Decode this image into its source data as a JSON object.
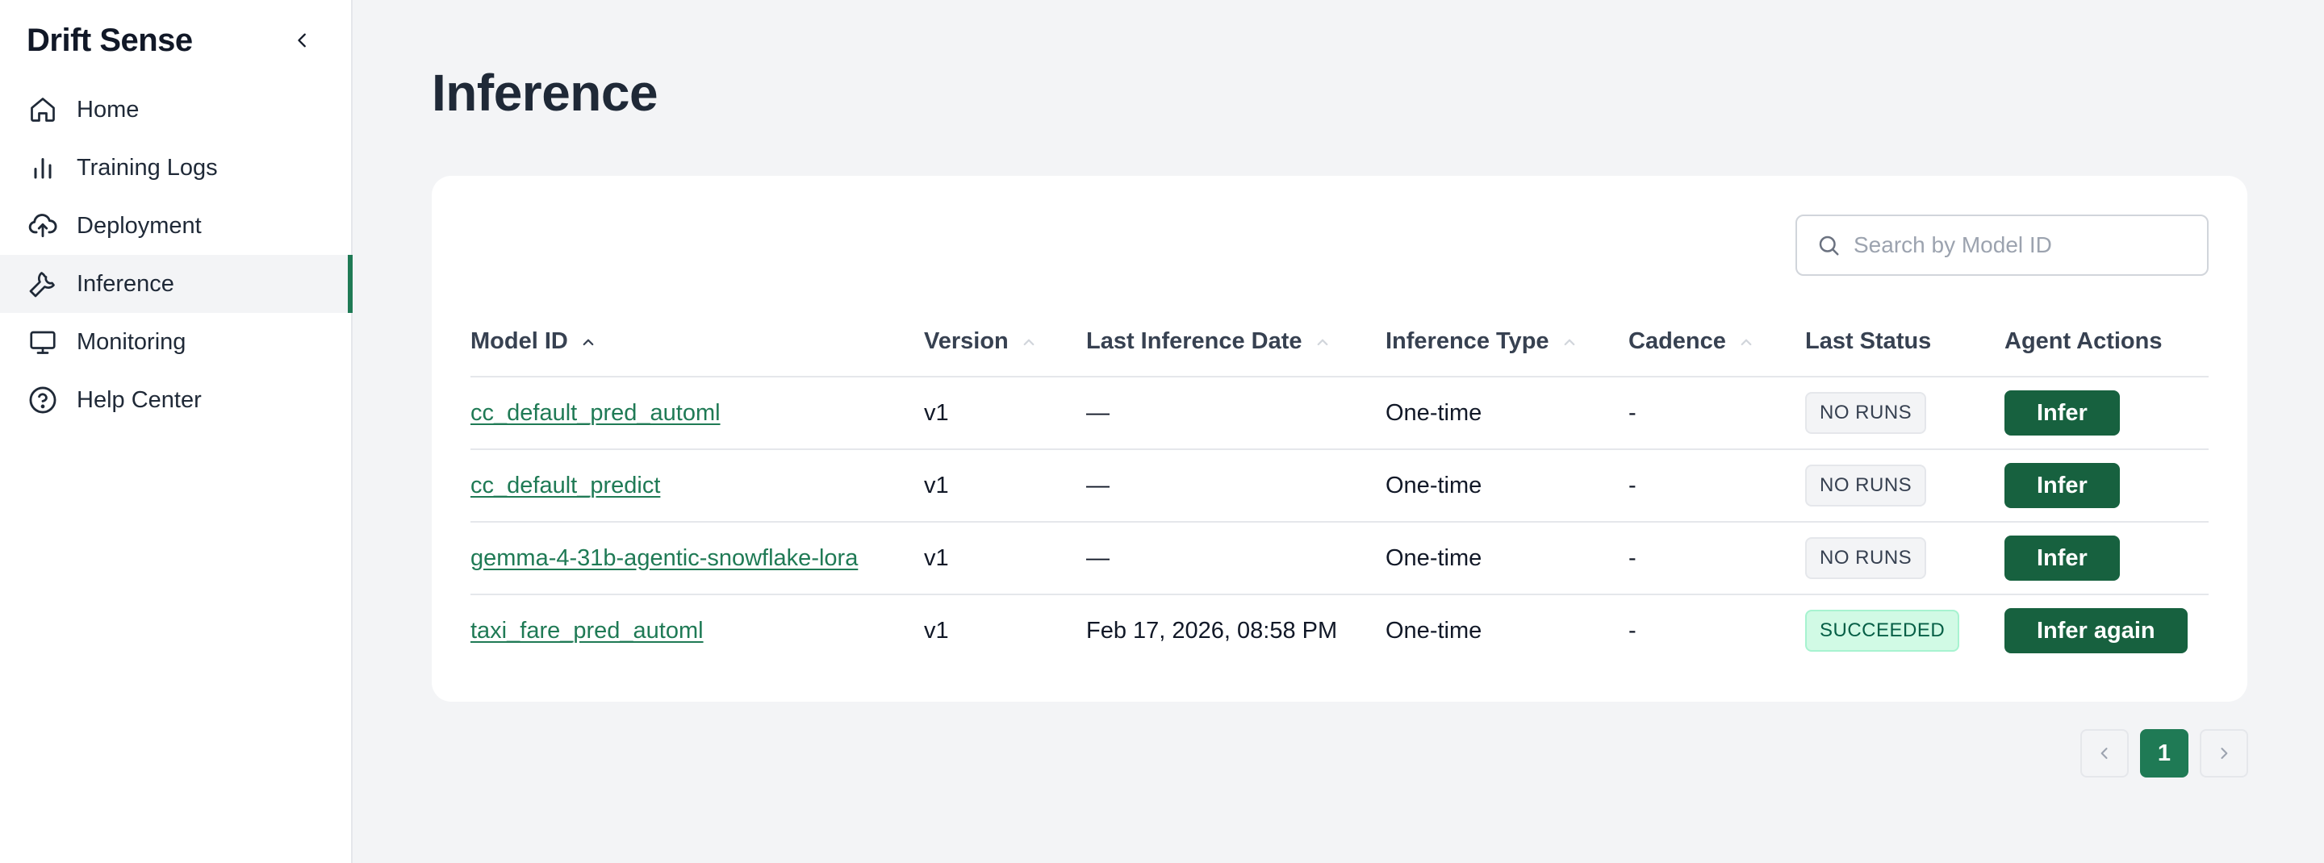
{
  "sidebar": {
    "brand": "Drift Sense",
    "items": [
      {
        "label": "Home",
        "icon": "home-icon"
      },
      {
        "label": "Training Logs",
        "icon": "bar-chart-icon"
      },
      {
        "label": "Deployment",
        "icon": "cloud-upload-icon"
      },
      {
        "label": "Inference",
        "icon": "wrench-icon",
        "active": true
      },
      {
        "label": "Monitoring",
        "icon": "monitor-icon"
      },
      {
        "label": "Help Center",
        "icon": "help-circle-icon"
      }
    ]
  },
  "page": {
    "title": "Inference"
  },
  "search": {
    "placeholder": "Search by Model ID"
  },
  "table": {
    "headers": {
      "model_id": "Model ID",
      "version": "Version",
      "last_inference_date": "Last Inference Date",
      "inference_type": "Inference Type",
      "cadence": "Cadence",
      "last_status": "Last Status",
      "agent_actions": "Agent Actions"
    },
    "rows": [
      {
        "model_id": "cc_default_pred_automl",
        "version": "v1",
        "last_inference_date": "—",
        "inference_type": "One-time",
        "cadence": "-",
        "status": "NO RUNS",
        "action": "Infer"
      },
      {
        "model_id": "cc_default_predict",
        "version": "v1",
        "last_inference_date": "—",
        "inference_type": "One-time",
        "cadence": "-",
        "status": "NO RUNS",
        "action": "Infer"
      },
      {
        "model_id": "gemma-4-31b-agentic-snowflake-lora",
        "version": "v1",
        "last_inference_date": "—",
        "inference_type": "One-time",
        "cadence": "-",
        "status": "NO RUNS",
        "action": "Infer"
      },
      {
        "model_id": "taxi_fare_pred_automl",
        "version": "v1",
        "last_inference_date": "Feb 17, 2026, 08:58 PM",
        "inference_type": "One-time",
        "cadence": "-",
        "status": "SUCCEEDED",
        "action": "Infer again"
      }
    ]
  },
  "pagination": {
    "current_page": "1"
  },
  "colors": {
    "accent": "#1f7a55",
    "button": "#17613f",
    "success_bg": "#d1fae5",
    "success_text": "#065f46"
  }
}
